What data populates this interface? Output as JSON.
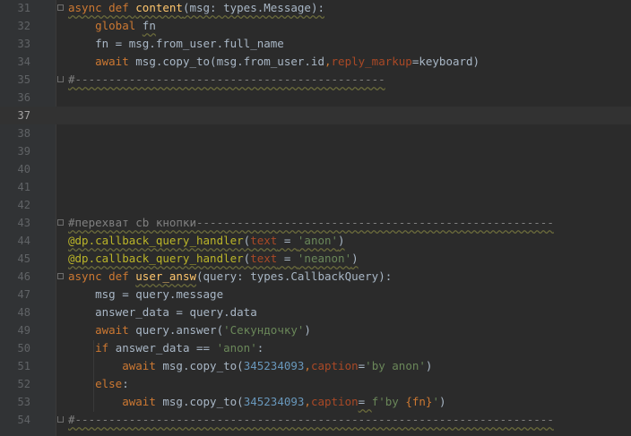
{
  "editor": {
    "current_line": "37",
    "lines": [
      {
        "no": "31",
        "tokens": [
          {
            "t": "async def ",
            "c": "kw wavy"
          },
          {
            "t": "content",
            "c": "fn wavy"
          },
          {
            "t": "(msg: types.Message):",
            "c": "wavy"
          }
        ]
      },
      {
        "no": "32",
        "tokens": [
          {
            "t": "    "
          },
          {
            "t": "global ",
            "c": "kw"
          },
          {
            "t": "fn",
            "c": "wavy"
          }
        ]
      },
      {
        "no": "33",
        "tokens": [
          {
            "t": "    fn = msg.from_user.full_name"
          }
        ]
      },
      {
        "no": "34",
        "tokens": [
          {
            "t": "    "
          },
          {
            "t": "await ",
            "c": "kw"
          },
          {
            "t": "msg.copy_to(msg.from_user.id"
          },
          {
            "t": ",",
            "c": "kw"
          },
          {
            "t": "reply_markup",
            "c": "param"
          },
          {
            "t": "=keyboard)"
          }
        ]
      },
      {
        "no": "35",
        "tokens": [
          {
            "t": "#----------------------------------------------",
            "c": "cmt wavy"
          }
        ]
      },
      {
        "no": "36",
        "tokens": []
      },
      {
        "no": "37",
        "tokens": []
      },
      {
        "no": "38",
        "tokens": []
      },
      {
        "no": "39",
        "tokens": []
      },
      {
        "no": "40",
        "tokens": []
      },
      {
        "no": "41",
        "tokens": []
      },
      {
        "no": "42",
        "tokens": []
      },
      {
        "no": "43",
        "tokens": [
          {
            "t": "#перехват cb кнопки-----------------------------------------------------",
            "c": "cmt wavy"
          }
        ]
      },
      {
        "no": "44",
        "tokens": [
          {
            "t": "@dp.callback_query_handler",
            "c": "dec wavy"
          },
          {
            "t": "(",
            "c": "wavy"
          },
          {
            "t": "text",
            "c": "param wavy"
          },
          {
            "t": " = ",
            "c": "wavy"
          },
          {
            "t": "'anon'",
            "c": "str wavy"
          },
          {
            "t": ")",
            "c": "wavy"
          }
        ]
      },
      {
        "no": "45",
        "tokens": [
          {
            "t": "@dp.callback_query_handler",
            "c": "dec wavy"
          },
          {
            "t": "(",
            "c": "wavy"
          },
          {
            "t": "text",
            "c": "param wavy"
          },
          {
            "t": " = ",
            "c": "wavy"
          },
          {
            "t": "'neanon'",
            "c": "str wavy"
          },
          {
            "t": ")",
            "c": "wavy"
          }
        ]
      },
      {
        "no": "46",
        "tokens": [
          {
            "t": "async def ",
            "c": "kw"
          },
          {
            "t": "user_answ",
            "c": "fn wavy"
          },
          {
            "t": "(query: types.CallbackQuery):"
          }
        ]
      },
      {
        "no": "47",
        "tokens": [
          {
            "t": "    msg = query.message"
          }
        ]
      },
      {
        "no": "48",
        "tokens": [
          {
            "t": "    answer_data = query.data"
          }
        ]
      },
      {
        "no": "49",
        "tokens": [
          {
            "t": "    "
          },
          {
            "t": "await ",
            "c": "kw"
          },
          {
            "t": "query.answer("
          },
          {
            "t": "'Секундочку'",
            "c": "str"
          },
          {
            "t": ")"
          }
        ]
      },
      {
        "no": "50",
        "tokens": [
          {
            "t": "    "
          },
          {
            "t": "if ",
            "c": "kw"
          },
          {
            "t": "answer_data == "
          },
          {
            "t": "'anon'",
            "c": "str"
          },
          {
            "t": ":"
          }
        ]
      },
      {
        "no": "51",
        "tokens": [
          {
            "t": "        "
          },
          {
            "t": "await ",
            "c": "kw"
          },
          {
            "t": "msg.copy_to("
          },
          {
            "t": "345234093",
            "c": "num"
          },
          {
            "t": ",",
            "c": "kw"
          },
          {
            "t": "caption",
            "c": "param"
          },
          {
            "t": "="
          },
          {
            "t": "'by anon'",
            "c": "str"
          },
          {
            "t": ")"
          }
        ]
      },
      {
        "no": "52",
        "tokens": [
          {
            "t": "    "
          },
          {
            "t": "else",
            "c": "kw"
          },
          {
            "t": ":"
          }
        ]
      },
      {
        "no": "53",
        "tokens": [
          {
            "t": "        "
          },
          {
            "t": "await ",
            "c": "kw"
          },
          {
            "t": "msg.copy_to("
          },
          {
            "t": "345234093",
            "c": "num"
          },
          {
            "t": ",",
            "c": "kw"
          },
          {
            "t": "caption",
            "c": "param"
          },
          {
            "t": "= ",
            "c": "wavy"
          },
          {
            "t": "f'by ",
            "c": "str"
          },
          {
            "t": "{fn}",
            "c": "kw"
          },
          {
            "t": "'",
            "c": "str"
          },
          {
            "t": ")"
          }
        ]
      },
      {
        "no": "54",
        "tokens": [
          {
            "t": "#-----------------------------------------------------------------------",
            "c": "cmt wavy"
          }
        ]
      }
    ]
  }
}
